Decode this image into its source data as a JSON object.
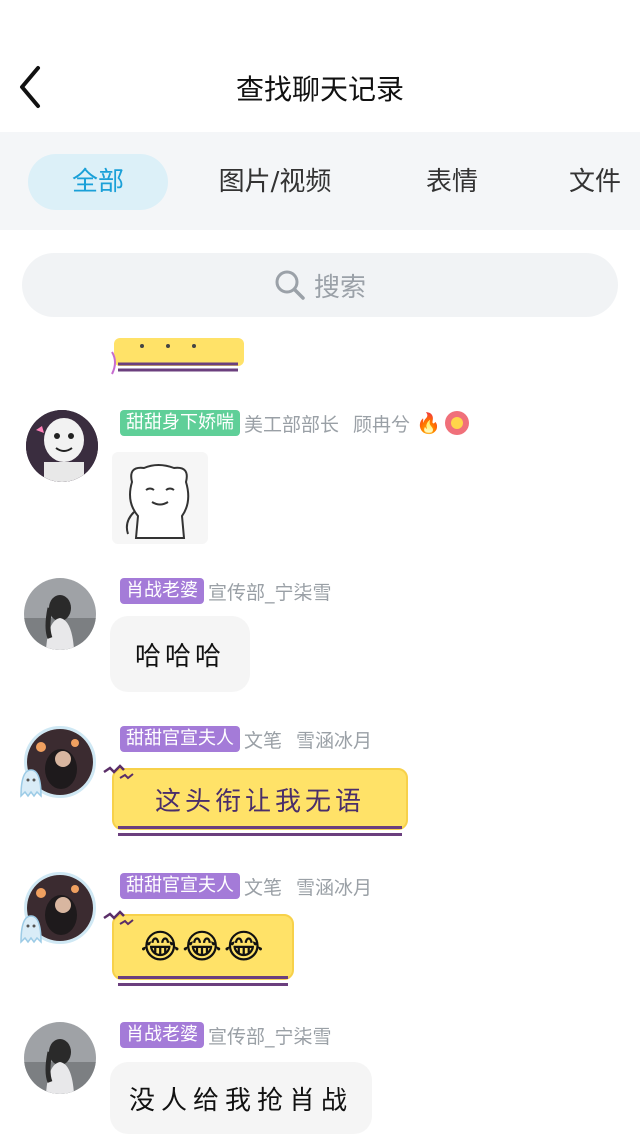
{
  "header": {
    "title": "查找聊天记录",
    "back_label": "返回"
  },
  "tabs": [
    {
      "label": "全部",
      "active": true
    },
    {
      "label": "图片/视频",
      "active": false
    },
    {
      "label": "表情",
      "active": false
    },
    {
      "label": "文件",
      "active": false
    }
  ],
  "search": {
    "placeholder": "搜索"
  },
  "messages": [
    {
      "badge": "甜甜身下娇喘",
      "badge_color": "#5fcf98",
      "subtitle": "美工部部长",
      "name": "顾冉兮",
      "emoji": [
        "fire-icon",
        "flower-icon"
      ],
      "content_type": "sticker"
    },
    {
      "badge": "肖战老婆",
      "badge_color": "#a47bd8",
      "subtitle": "宣传部_宁柒雪",
      "name": "",
      "content_type": "text",
      "text": "哈哈哈"
    },
    {
      "badge": "甜甜官宣夫人",
      "badge_color": "#a47bd8",
      "subtitle": "文笔",
      "name": "雪涵冰月",
      "content_type": "text",
      "text": "这头衔让我无语"
    },
    {
      "badge": "甜甜官宣夫人",
      "badge_color": "#a47bd8",
      "subtitle": "文笔",
      "name": "雪涵冰月",
      "content_type": "emoji",
      "text": "😂😂😂"
    },
    {
      "badge": "肖战老婆",
      "badge_color": "#a47bd8",
      "subtitle": "宣传部_宁柒雪",
      "name": "",
      "content_type": "text",
      "text": "没人给我抢肖战"
    }
  ]
}
